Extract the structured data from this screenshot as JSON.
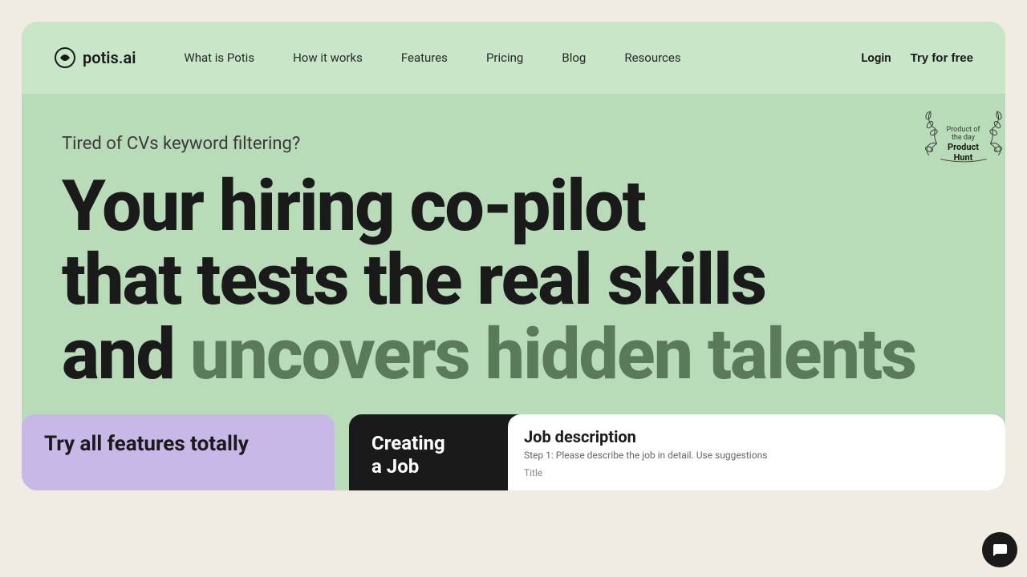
{
  "page": {
    "background_color": "#f0ece4"
  },
  "navbar": {
    "logo_text": "potis.ai",
    "links": [
      {
        "label": "What is Potis",
        "id": "what-is-potis"
      },
      {
        "label": "How it works",
        "id": "how-it-works"
      },
      {
        "label": "Features",
        "id": "features"
      },
      {
        "label": "Pricing",
        "id": "pricing"
      },
      {
        "label": "Blog",
        "id": "blog"
      },
      {
        "label": "Resources",
        "id": "resources"
      }
    ],
    "login_label": "Login",
    "try_free_label": "Try for free"
  },
  "hero": {
    "subtitle": "Tired of CVs keyword filtering?",
    "headline_line1": "Your hiring co-pilot",
    "headline_line2": "that tests the real skills",
    "headline_line3_prefix": "and ",
    "headline_line3_highlight": "uncovers hidden talents",
    "product_hunt_line1": "Product of the day",
    "product_hunt_line2": "Product Hunt"
  },
  "bottom": {
    "purple_card_text": "Try all features totally",
    "dark_card_title_line1": "Creating",
    "dark_card_title_line2": "a Job",
    "job_desc_title": "Job description",
    "job_desc_subtitle": "Step 1: Please describe the job in detail. Use suggestions",
    "job_desc_field_label": "Title"
  }
}
